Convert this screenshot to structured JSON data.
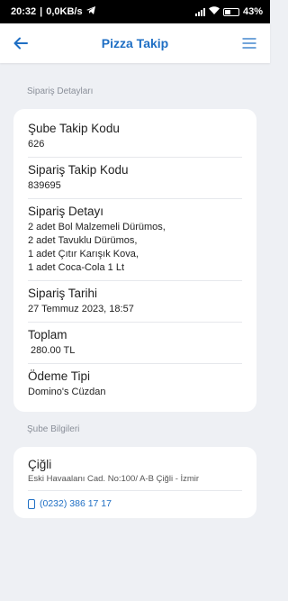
{
  "status": {
    "time": "20:32",
    "speed": "0,0KB/s",
    "battery": "43"
  },
  "appbar": {
    "title": "Pizza Takip"
  },
  "order_section": {
    "label": "Sipariş Detayları"
  },
  "order": [
    {
      "label": "Şube Takip Kodu",
      "value": "626"
    },
    {
      "label": "Sipariş Takip Kodu",
      "value": "839695"
    },
    {
      "label": "Sipariş Detayı",
      "value": [
        "2 adet  Bol Malzemeli Dürümos,",
        "2 adet  Tavuklu Dürümos,",
        "1 adet Çıtır Karışık Kova,",
        "1 adet Coca-Cola 1 Lt"
      ]
    },
    {
      "label": "Sipariş Tarihi",
      "value": "27 Temmuz 2023, 18:57"
    },
    {
      "label": "Toplam",
      "value": " 280.00 TL"
    },
    {
      "label": "Ödeme Tipi",
      "value": "Domino's Cüzdan"
    }
  ],
  "branch_section": {
    "label": "Şube Bilgileri"
  },
  "branch": {
    "name": "Çiğli",
    "address": "Eski Havaalanı Cad. No:100/ A-B Çiğli - İzmir",
    "phone": "(0232) 386 17 17"
  },
  "colors": {
    "accent": "#1f6fc4",
    "background": "#eef0f4"
  }
}
